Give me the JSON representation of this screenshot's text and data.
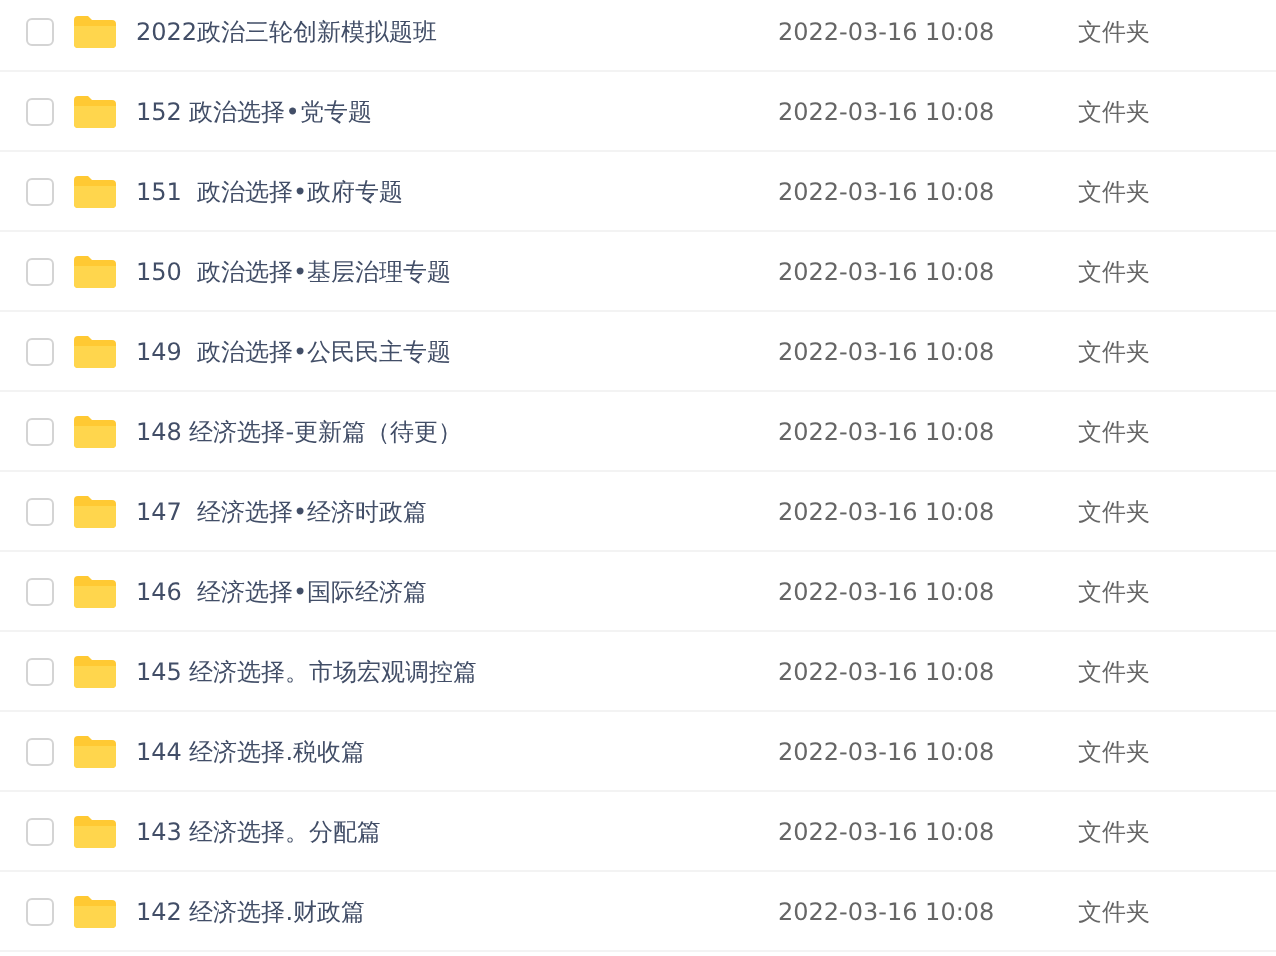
{
  "files": [
    {
      "name": "2022政治三轮创新模拟题班",
      "modified": "2022-03-16 10:08",
      "type": "文件夹",
      "checked": false
    },
    {
      "name": "152 政治选择•党专题",
      "modified": "2022-03-16 10:08",
      "type": "文件夹",
      "checked": false
    },
    {
      "name": "151  政治选择•政府专题",
      "modified": "2022-03-16 10:08",
      "type": "文件夹",
      "checked": false
    },
    {
      "name": "150  政治选择•基层治理专题",
      "modified": "2022-03-16 10:08",
      "type": "文件夹",
      "checked": false
    },
    {
      "name": "149  政治选择•公民民主专题",
      "modified": "2022-03-16 10:08",
      "type": "文件夹",
      "checked": false
    },
    {
      "name": "148 经济选择-更新篇（待更）",
      "modified": "2022-03-16 10:08",
      "type": "文件夹",
      "checked": false
    },
    {
      "name": "147  经济选择•经济时政篇",
      "modified": "2022-03-16 10:08",
      "type": "文件夹",
      "checked": false
    },
    {
      "name": "146  经济选择•国际经济篇",
      "modified": "2022-03-16 10:08",
      "type": "文件夹",
      "checked": false
    },
    {
      "name": "145 经济选择。市场宏观调控篇",
      "modified": "2022-03-16 10:08",
      "type": "文件夹",
      "checked": false
    },
    {
      "name": "144 经济选择.税收篇",
      "modified": "2022-03-16 10:08",
      "type": "文件夹",
      "checked": false
    },
    {
      "name": "143 经济选择。分配篇",
      "modified": "2022-03-16 10:08",
      "type": "文件夹",
      "checked": false
    },
    {
      "name": "142 经济选择.财政篇",
      "modified": "2022-03-16 10:08",
      "type": "文件夹",
      "checked": false
    }
  ]
}
